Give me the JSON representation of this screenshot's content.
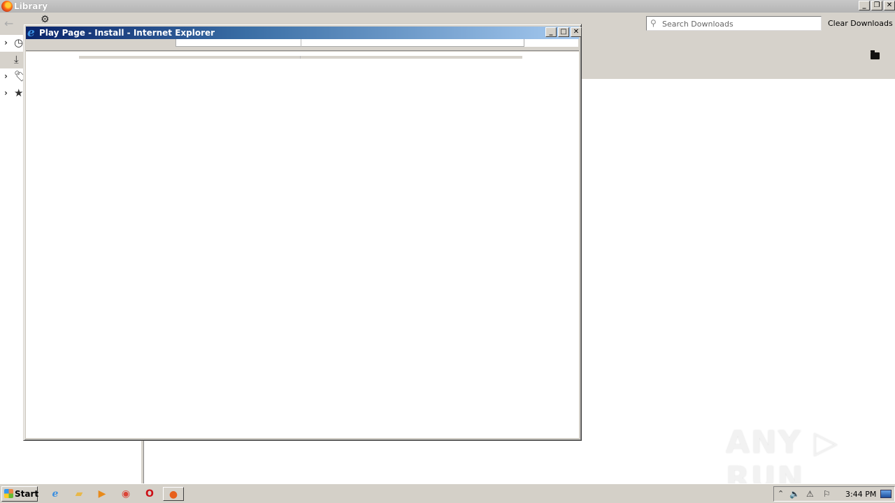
{
  "library": {
    "title": "Library",
    "search_placeholder": "Search Downloads",
    "clear_downloads_label": "Clear Downloads",
    "sidebar": [
      {
        "name": "history",
        "icon": "clock-icon",
        "expandable": true
      },
      {
        "name": "downloads",
        "icon": "download-icon",
        "expandable": false,
        "selected": true
      },
      {
        "name": "tags",
        "icon": "tag-icon",
        "expandable": true
      },
      {
        "name": "all-bookmarks",
        "icon": "star-icon",
        "expandable": true
      }
    ]
  },
  "ie_window": {
    "title": "Play Page - Install - Internet Explorer"
  },
  "taskbar": {
    "start_label": "Start",
    "apps": [
      {
        "name": "internet-explorer",
        "icon": "ie-icon"
      },
      {
        "name": "file-explorer",
        "icon": "folder-icon"
      },
      {
        "name": "media-player",
        "icon": "media-player-icon"
      },
      {
        "name": "chrome",
        "icon": "chrome-icon"
      },
      {
        "name": "opera",
        "icon": "opera-icon"
      },
      {
        "name": "firefox",
        "icon": "firefox-icon",
        "active": true
      }
    ],
    "clock": "3:44 PM"
  },
  "watermark": {
    "text_left": "ANY",
    "text_right": "RUN"
  },
  "glyphs": {
    "minimize": "_",
    "maximize": "□",
    "restore": "❐",
    "close": "✕",
    "chevron": "›",
    "back": "←",
    "search": "⚲",
    "play": "▷"
  }
}
